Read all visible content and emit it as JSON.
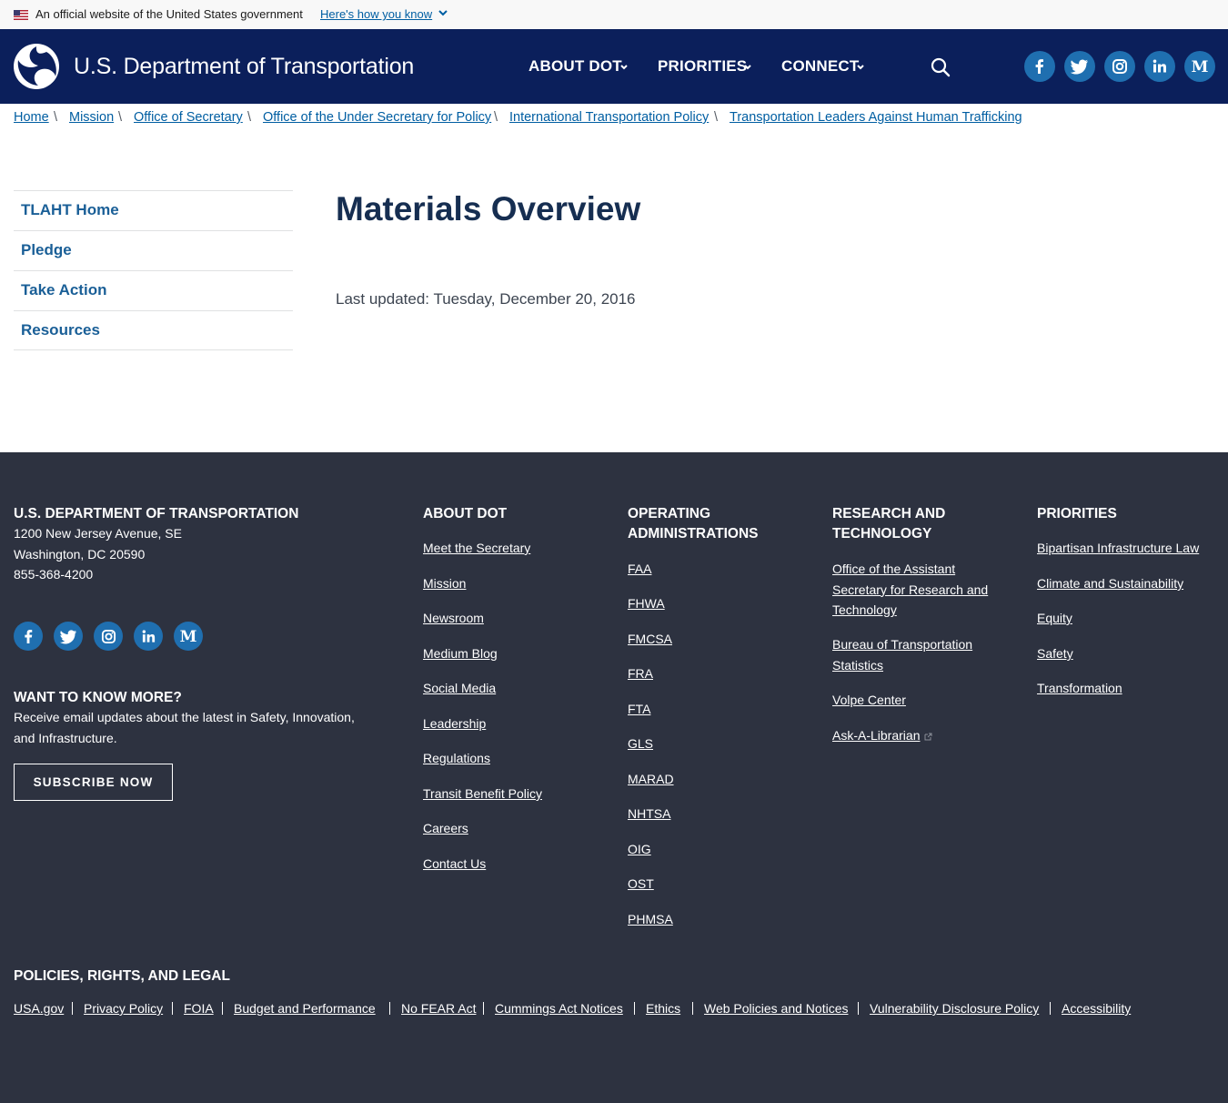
{
  "gov_banner": {
    "text": "An official website of the United States government",
    "link": "Here's how you know"
  },
  "header": {
    "site_title": "U.S. Department of Transportation",
    "nav": [
      {
        "label": "ABOUT DOT"
      },
      {
        "label": "PRIORITIES"
      },
      {
        "label": "CONNECT"
      }
    ],
    "social_icons": [
      "facebook-icon",
      "twitter-icon",
      "instagram-icon",
      "linkedin-icon",
      "medium-icon"
    ]
  },
  "breadcrumb": [
    "Home",
    "Mission",
    "Office of Secretary",
    "Office of the Under Secretary for Policy",
    "International Transportation Policy",
    "Transportation Leaders Against Human Trafficking"
  ],
  "breadcrumb_separator": "\\",
  "sidenav": [
    {
      "label": "TLAHT Home"
    },
    {
      "label": "Pledge"
    },
    {
      "label": "Take Action"
    },
    {
      "label": "Resources"
    }
  ],
  "main": {
    "title": "Materials Overview",
    "last_updated": "Last updated: Tuesday, December 20, 2016"
  },
  "footer": {
    "org": {
      "heading": "U.S. DEPARTMENT OF TRANSPORTATION",
      "address_line1": "1200 New Jersey Avenue, SE",
      "address_line2": "Washington, DC 20590",
      "phone": "855-368-4200"
    },
    "newsletter": {
      "heading": "WANT TO KNOW MORE?",
      "text_line1": "Receive email updates about the latest in Safety, Innovation,",
      "text_line2": "and Infrastructure.",
      "button": "SUBSCRIBE NOW"
    },
    "about": {
      "heading": "ABOUT DOT",
      "links": [
        "Meet the Secretary",
        "Mission",
        "Newsroom",
        "Medium Blog",
        "Social Media",
        "Leadership",
        "Regulations",
        "Transit Benefit Policy",
        "Careers",
        "Contact Us"
      ]
    },
    "operating": {
      "heading_line1": "OPERATING",
      "heading_line2": "ADMINISTRATIONS",
      "links": [
        "FAA",
        "FHWA",
        "FMCSA",
        "FRA",
        "FTA",
        "GLS",
        "MARAD",
        "NHTSA",
        "OIG",
        "OST",
        "PHMSA"
      ]
    },
    "research": {
      "heading_line1": "RESEARCH AND",
      "heading_line2": "TECHNOLOGY",
      "links": [
        "Office of the Assistant Secretary for Research and Technology",
        "Bureau of Transportation Statistics",
        "Volpe Center",
        "Ask-A-Librarian"
      ]
    },
    "priorities": {
      "heading": "PRIORITIES",
      "links": [
        "Bipartisan Infrastructure Law",
        "Climate and Sustainability",
        "Equity",
        "Safety",
        "Transformation"
      ]
    },
    "legal": {
      "heading": "POLICIES, RIGHTS, AND LEGAL",
      "links": [
        "USA.gov",
        "Privacy Policy",
        "FOIA",
        "Budget and Performance",
        "No FEAR Act",
        "Cummings Act Notices",
        "Ethics",
        "Web Policies and Notices",
        "Vulnerability Disclosure Policy",
        "Accessibility"
      ]
    }
  },
  "colors": {
    "header_bg": "#0b1f5b",
    "footer_bg": "#2d3240",
    "link_blue": "#005ea2",
    "title_navy": "#162e51",
    "social_blue": "#1f6fb0"
  }
}
